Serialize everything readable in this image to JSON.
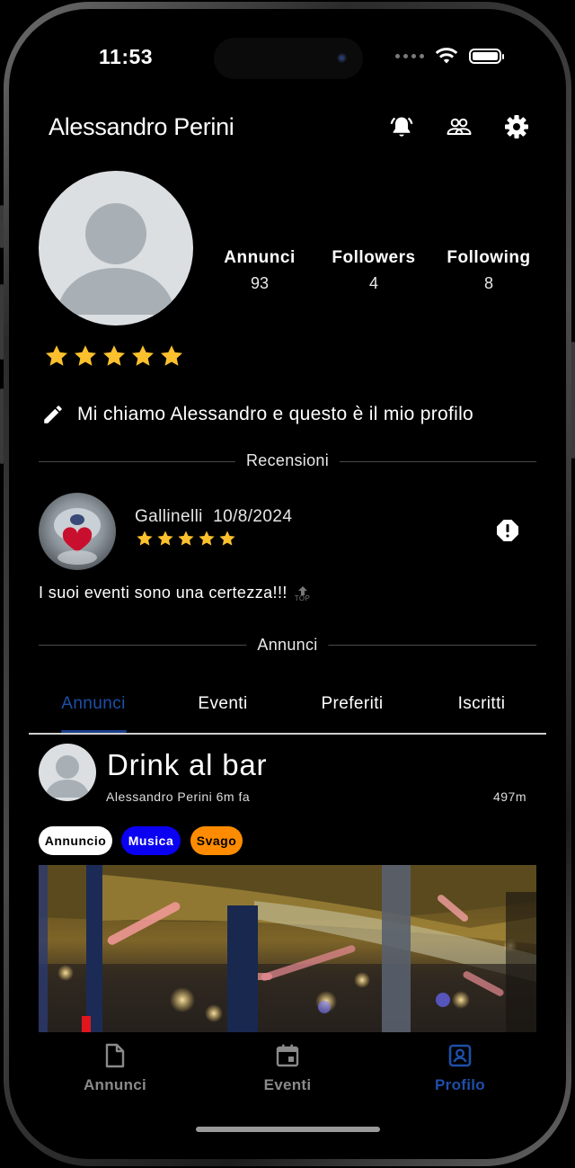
{
  "status_bar": {
    "time": "11:53"
  },
  "header": {
    "username": "Alessandro Perini"
  },
  "profile": {
    "stats": [
      {
        "label": "Annunci",
        "value": "93"
      },
      {
        "label": "Followers",
        "value": "4"
      },
      {
        "label": "Following",
        "value": "8"
      }
    ],
    "rating_stars": 5,
    "bio": "Mi chiamo Alessandro e questo è il mio profilo"
  },
  "reviews_section": {
    "title": "Recensioni",
    "review": {
      "author": "Gallinelli",
      "date": "10/8/2024",
      "stars": 5,
      "text": "I suoi eventi sono una certezza!!!",
      "top_icon_label": "TOP"
    }
  },
  "ads_section": {
    "title": "Annunci"
  },
  "tabs": [
    {
      "label": "Annunci",
      "active": true
    },
    {
      "label": "Eventi",
      "active": false
    },
    {
      "label": "Preferiti",
      "active": false
    },
    {
      "label": "Iscritti",
      "active": false
    }
  ],
  "post": {
    "title": "Drink al bar",
    "author": "Alessandro Perini",
    "time_ago": "6m fa",
    "distance": "497m",
    "tags": [
      {
        "label": "Annuncio",
        "bg": "#ffffff",
        "fg": "#000000"
      },
      {
        "label": "Musica",
        "bg": "#0a00f2",
        "fg": "#ffffff"
      },
      {
        "label": "Svago",
        "bg": "#ff8c00",
        "fg": "#000000"
      }
    ]
  },
  "bottom_nav": [
    {
      "label": "Annunci",
      "icon": "document-icon",
      "active": false
    },
    {
      "label": "Eventi",
      "icon": "calendar-icon",
      "active": false
    },
    {
      "label": "Profilo",
      "icon": "profile-icon",
      "active": true
    }
  ],
  "colors": {
    "accent": "#1e4fa8",
    "star": "#fbc02d",
    "background": "#000000"
  }
}
